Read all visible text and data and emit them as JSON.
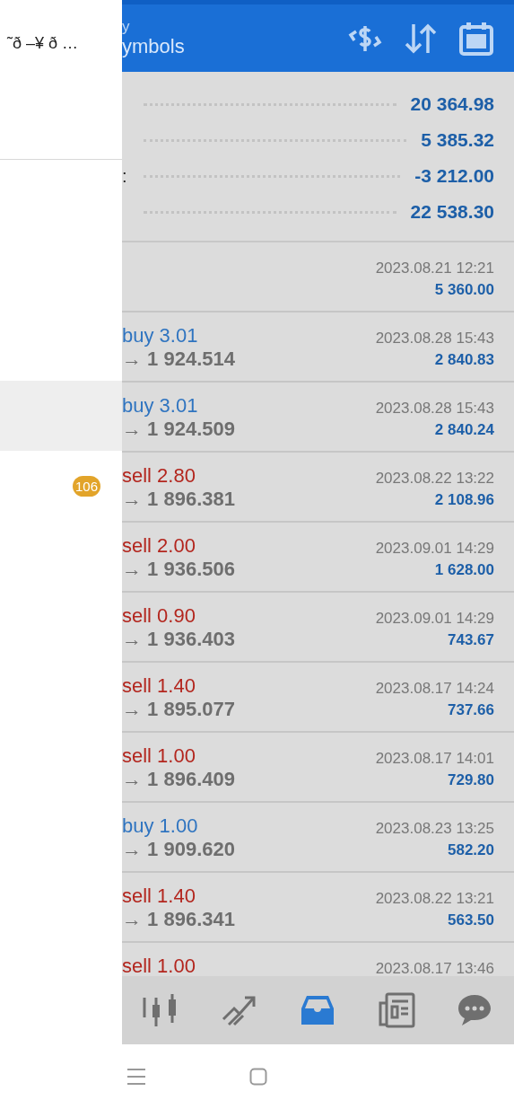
{
  "drawer": {
    "title": "˜ð –¥ ð …",
    "rows": [
      {
        "selected": true
      },
      {
        "selected": false,
        "badge": "106"
      }
    ]
  },
  "header": {
    "title_line_1": "y",
    "title_line_2": "ymbols"
  },
  "summary": [
    {
      "value": "20 364.98"
    },
    {
      "value": "5 385.32"
    },
    {
      "label": ":",
      "value": "-3 212.00"
    },
    {
      "value": "22 538.30"
    }
  ],
  "deals": [
    {
      "kind": "balance",
      "time": "2023.08.21 12:21",
      "amount": "5 360.00"
    },
    {
      "kind": "trade",
      "type": "buy 3.01",
      "color": "#2f74c0",
      "price": "→ 1 924.514",
      "time": "2023.08.28 15:43",
      "amount": "2 840.83"
    },
    {
      "kind": "trade",
      "type": "buy 3.01",
      "color": "#2f74c0",
      "price": "→ 1 924.509",
      "time": "2023.08.28 15:43",
      "amount": "2 840.24"
    },
    {
      "kind": "trade",
      "type": "sell 2.80",
      "color": "#b3261e",
      "price": "→ 1 896.381",
      "time": "2023.08.22 13:22",
      "amount": "2 108.96"
    },
    {
      "kind": "trade",
      "type": "sell 2.00",
      "color": "#b3261e",
      "price": "→ 1 936.506",
      "time": "2023.09.01 14:29",
      "amount": "1 628.00"
    },
    {
      "kind": "trade",
      "type": "sell 0.90",
      "color": "#b3261e",
      "price": "→ 1 936.403",
      "time": "2023.09.01 14:29",
      "amount": "743.67"
    },
    {
      "kind": "trade",
      "type": "sell 1.40",
      "color": "#b3261e",
      "price": "→ 1 895.077",
      "time": "2023.08.17 14:24",
      "amount": "737.66"
    },
    {
      "kind": "trade",
      "type": "sell 1.00",
      "color": "#b3261e",
      "price": "→ 1 896.409",
      "time": "2023.08.17 14:01",
      "amount": "729.80"
    },
    {
      "kind": "trade",
      "type": "buy 1.00",
      "color": "#2f74c0",
      "price": "→ 1 909.620",
      "time": "2023.08.23 13:25",
      "amount": "582.20"
    },
    {
      "kind": "trade",
      "type": "sell 1.40",
      "color": "#b3261e",
      "price": "→ 1 896.341",
      "time": "2023.08.22 13:21",
      "amount": "563.50"
    },
    {
      "kind": "trade",
      "type": "sell 1.00",
      "color": "#b3261e",
      "time": "2023.08.17 13:46"
    }
  ],
  "bottom_nav": [
    {
      "kind": "candles",
      "selected": false
    },
    {
      "kind": "trend",
      "selected": false
    },
    {
      "kind": "inbox",
      "selected": true
    },
    {
      "kind": "news",
      "selected": false
    },
    {
      "kind": "chat",
      "selected": false
    }
  ]
}
